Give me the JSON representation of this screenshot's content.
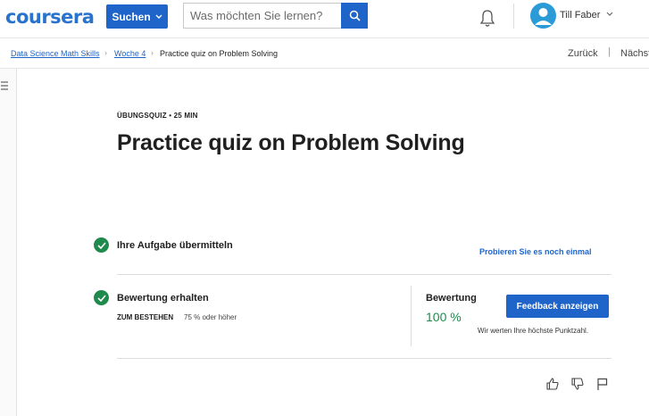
{
  "header": {
    "logo_text": "coursera",
    "search_button_label": "Suchen",
    "search_placeholder": "Was möchten Sie lernen?",
    "user_name": "Till Faber"
  },
  "breadcrumb": {
    "items": [
      "Data Science Math Skills",
      "Woche 4",
      "Practice quiz on Problem Solving"
    ],
    "back_label": "Zurück",
    "divider": "|",
    "next_label": "Nächst"
  },
  "quiz": {
    "kicker": "ÜBUNGSQUIZ • 25 MIN",
    "title": "Practice quiz on Problem Solving",
    "step1_title": "Ihre Aufgabe übermitteln",
    "retry_label": "Probieren Sie es noch einmal",
    "step2_title": "Bewertung erhalten",
    "pass_label": "ZUM BESTEHEN",
    "pass_value": "75 % oder höher",
    "grade_label": "Bewertung",
    "grade_value": "100 %",
    "feedback_button": "Feedback anzeigen",
    "grade_note": "Wir werten Ihre höchste Punktzahl."
  },
  "colors": {
    "accent": "#1f64c8",
    "success": "#1f8a4c",
    "logo": "#2a73cc"
  },
  "icons": [
    "search-icon",
    "chevron-down-icon",
    "bell-icon",
    "avatar-icon",
    "menu-icon",
    "check-icon",
    "thumbs-up-icon",
    "thumbs-down-icon",
    "flag-icon"
  ]
}
